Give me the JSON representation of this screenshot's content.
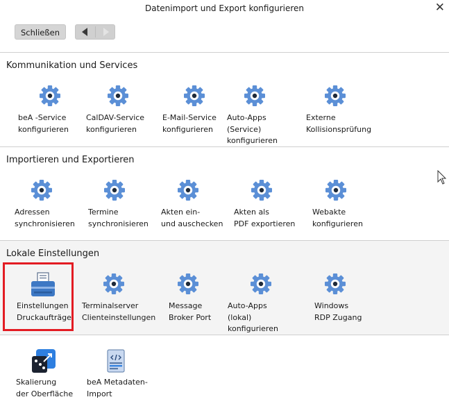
{
  "window": {
    "title": "Datenimport und Export konfigurieren"
  },
  "toolbar": {
    "close_label": "Schließen"
  },
  "sections": [
    {
      "title": "Kommunikation und Services",
      "items": [
        {
          "label": "beA -Service\nkonfigurieren",
          "icon": "gear-icon"
        },
        {
          "label": "CalDAV-Service\nkonfigurieren",
          "icon": "gear-icon"
        },
        {
          "label": "E-Mail-Service\nkonfigurieren",
          "icon": "gear-icon"
        },
        {
          "label": "Auto-Apps\n(Service)\nkonfigurieren",
          "icon": "gear-icon"
        },
        {
          "label": "Externe\nKollisionsprüfung",
          "icon": "gear-icon"
        }
      ]
    },
    {
      "title": "Importieren und Exportieren",
      "items": [
        {
          "label": "Adressen\nsynchronisieren",
          "icon": "gear-icon"
        },
        {
          "label": "Termine\nsynchronisieren",
          "icon": "gear-icon"
        },
        {
          "label": "Akten ein-\nund auschecken",
          "icon": "gear-icon"
        },
        {
          "label": "Akten als\nPDF exportieren",
          "icon": "gear-icon"
        },
        {
          "label": "Webakte\nkonfigurieren",
          "icon": "gear-icon"
        }
      ]
    },
    {
      "title": "Lokale Einstellungen",
      "items": [
        {
          "label": "Einstellungen\nDruckaufträge",
          "icon": "printer-icon"
        },
        {
          "label": "Terminalserver\nClienteinstellungen",
          "icon": "gear-icon"
        },
        {
          "label": "Message\nBroker Port",
          "icon": "gear-icon"
        },
        {
          "label": "Auto-Apps\n(lokal) konfigurieren",
          "icon": "gear-icon"
        },
        {
          "label": "Windows\nRDP Zugang",
          "icon": "gear-icon"
        }
      ]
    },
    {
      "title": "",
      "items": [
        {
          "label": "Skalierung\nder Oberfläche",
          "icon": "scaling-icon"
        },
        {
          "label": "beA Metadaten-\nImport",
          "icon": "code-document-icon"
        }
      ]
    }
  ],
  "colors": {
    "gear": "#5b8fd6",
    "highlight": "#e31c23",
    "section_grey": "#f4f4f4"
  }
}
